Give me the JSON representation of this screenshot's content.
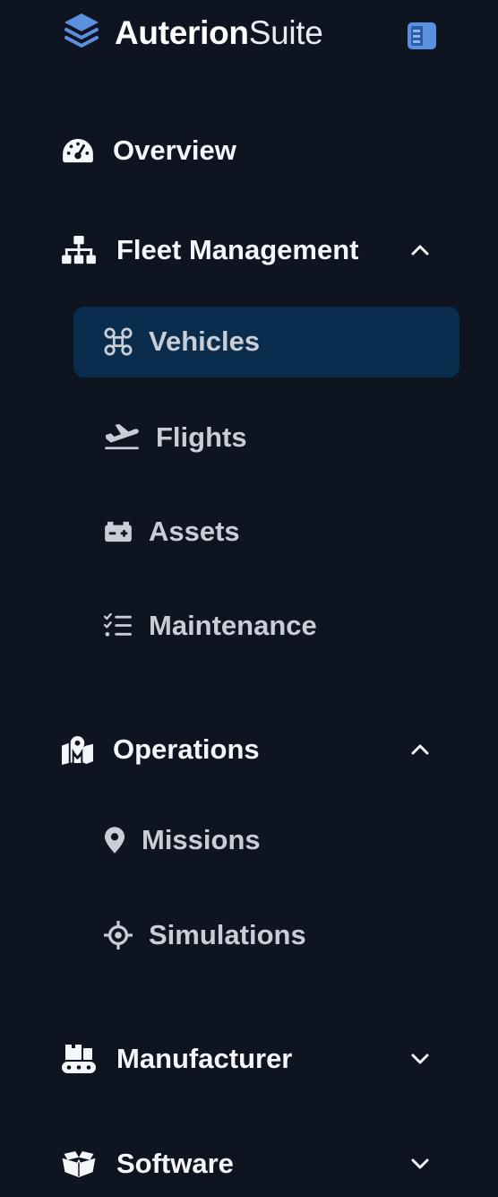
{
  "brand": {
    "name_bold": "Auterion",
    "name_light": "Suite"
  },
  "colors": {
    "background": "#0e1520",
    "active_bg": "#0a2c4d",
    "logo_blue": "#5b8fe0"
  },
  "nav": {
    "overview": {
      "label": "Overview",
      "icon": "gauge-icon"
    },
    "fleet": {
      "label": "Fleet Management",
      "icon": "sitemap-icon",
      "expanded": true,
      "items": [
        {
          "label": "Vehicles",
          "icon": "drone-icon",
          "active": true
        },
        {
          "label": "Flights",
          "icon": "plane-departure-icon"
        },
        {
          "label": "Assets",
          "icon": "battery-icon"
        },
        {
          "label": "Maintenance",
          "icon": "checklist-icon"
        }
      ]
    },
    "operations": {
      "label": "Operations",
      "icon": "map-location-icon",
      "expanded": true,
      "items": [
        {
          "label": "Missions",
          "icon": "location-pin-icon"
        },
        {
          "label": "Simulations",
          "icon": "crosshair-icon"
        }
      ]
    },
    "manufacturer": {
      "label": "Manufacturer",
      "icon": "factory-conveyor-icon",
      "expanded": false
    },
    "software": {
      "label": "Software",
      "icon": "open-box-icon",
      "expanded": false
    }
  }
}
